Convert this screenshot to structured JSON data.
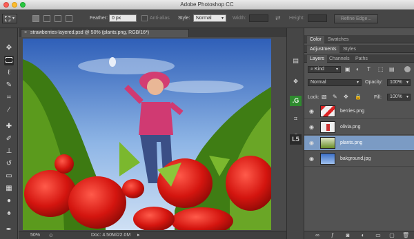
{
  "window": {
    "title": "Adobe Photoshop CC"
  },
  "options_bar": {
    "feather_label": "Feather:",
    "feather_value": "0 px",
    "antialias_label": "Anti-alias",
    "style_label": "Style:",
    "style_value": "Normal",
    "width_label": "Width:",
    "height_label": "Height:",
    "refine_edge": "Refine Edge..."
  },
  "document": {
    "tab_title": "strawberries-layered.psd @ 50% (plants.png, RGB/16*)",
    "zoom": "50%",
    "doc_size": "Doc: 4.50M/22.0M"
  },
  "panels": {
    "top_tabs": [
      "Color",
      "Swatches"
    ],
    "mid_tabs": [
      "Adjustments",
      "Styles"
    ],
    "layer_tabs": [
      "Layers",
      "Channels",
      "Paths"
    ],
    "kind_value": "Kind",
    "blend_mode": "Normal",
    "opacity_label": "Opacity:",
    "opacity_value": "100%",
    "lock_label": "Lock:",
    "fill_label": "Fill:",
    "fill_value": "100%",
    "layers": [
      {
        "name": "berries.png",
        "selected": false
      },
      {
        "name": "olivia.png",
        "selected": false
      },
      {
        "name": "plants.png",
        "selected": true
      },
      {
        "name": "bakground.jpg",
        "selected": false
      }
    ]
  },
  "colors": {
    "selected_layer": "#7b9bc4",
    "panel_bg": "#535353",
    "toolbar_bg": "#464646"
  }
}
